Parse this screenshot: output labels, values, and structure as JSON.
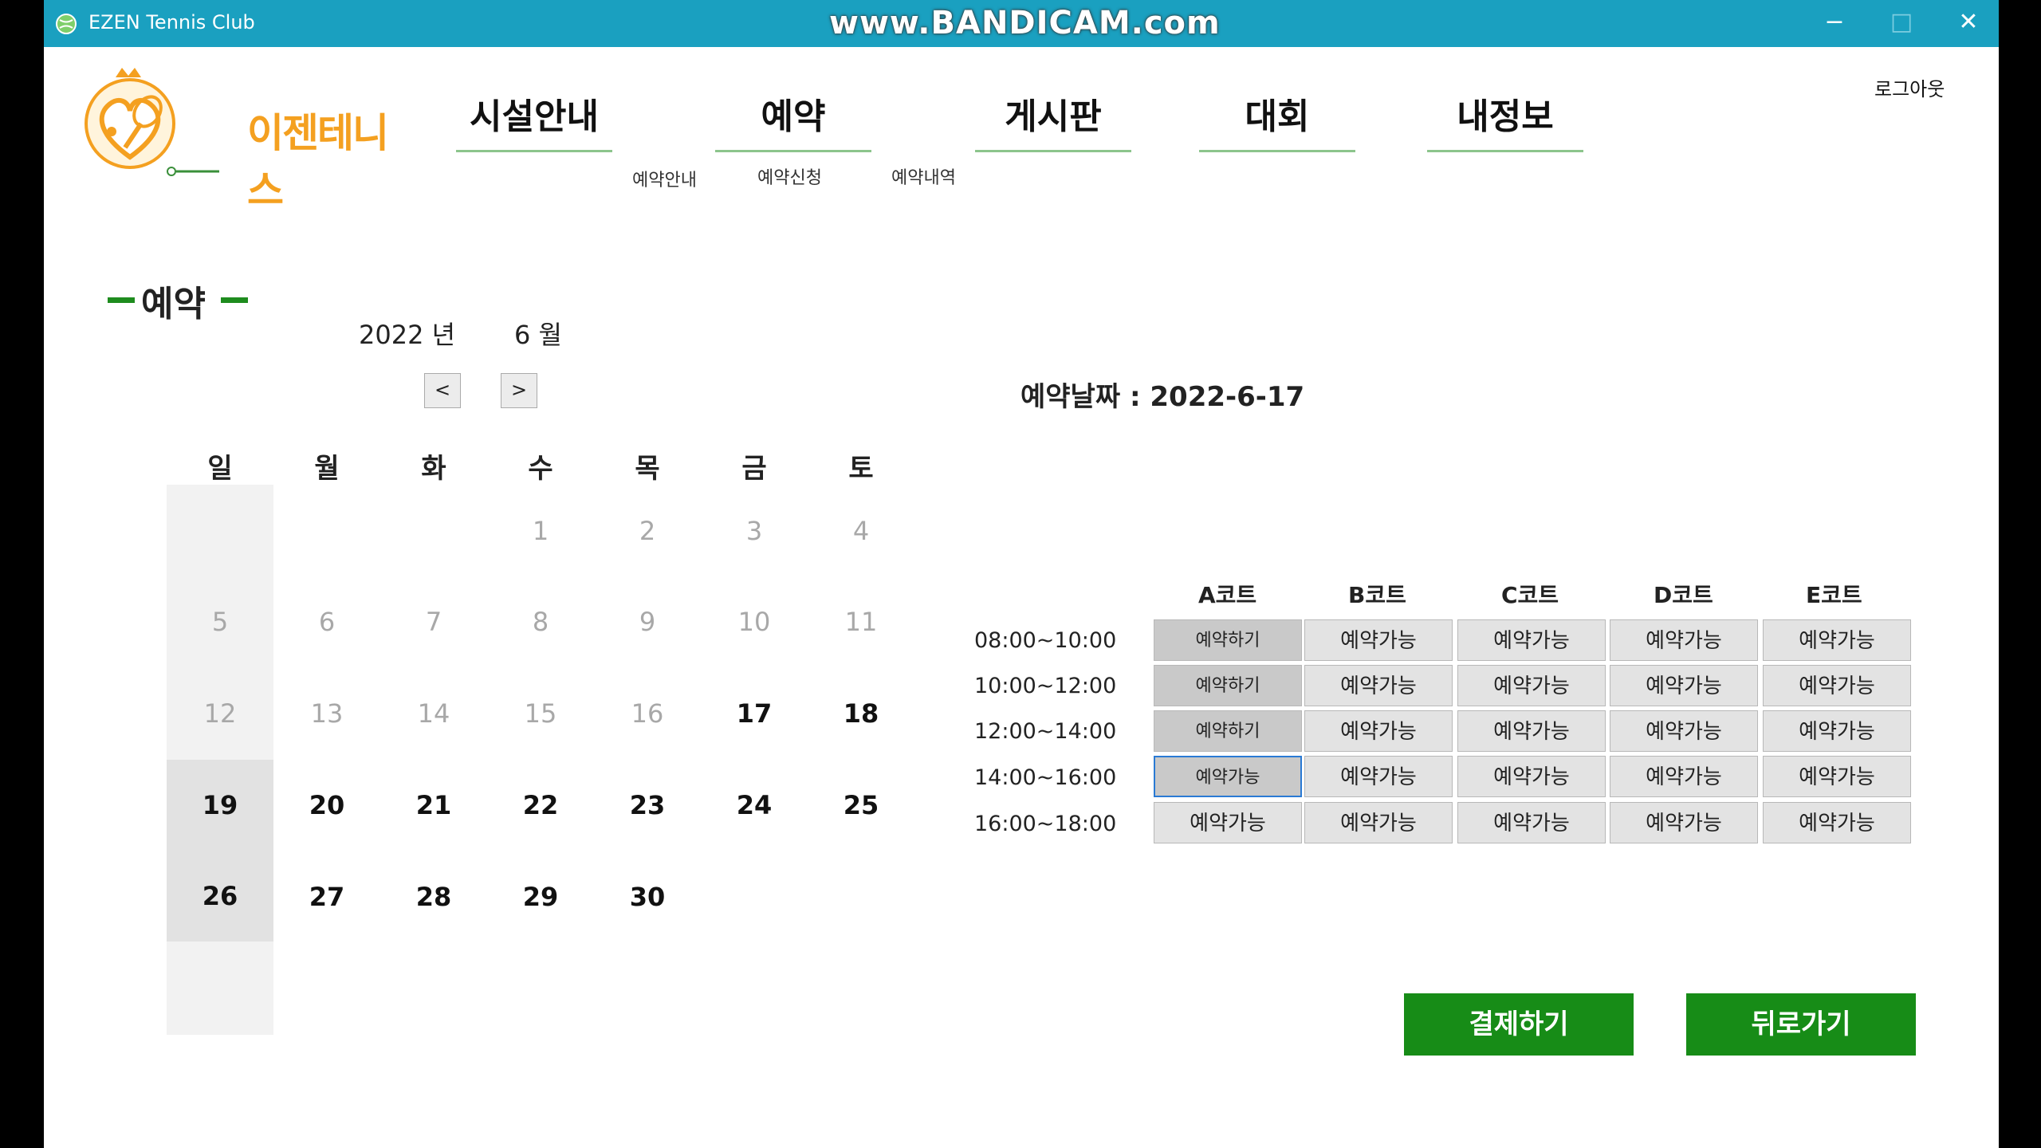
{
  "window": {
    "title": "EZEN Tennis Club",
    "watermark": "www.BANDICAM.com",
    "controls": {
      "minimize": "−",
      "maximize": "□",
      "close": "✕"
    }
  },
  "logo": {
    "text": "이젠테니스"
  },
  "nav": {
    "items": [
      {
        "label": "시설안내"
      },
      {
        "label": "예약"
      },
      {
        "label": "게시판"
      },
      {
        "label": "대회"
      },
      {
        "label": "내정보"
      }
    ],
    "sub_items": [
      {
        "label": "예약안내"
      },
      {
        "label": "예약신청"
      },
      {
        "label": "예약내역"
      }
    ],
    "logout": "로그아웃"
  },
  "section_title": "예약",
  "calendar": {
    "year_label": "2022 년",
    "month_label": "6 월",
    "prev_label": "<",
    "next_label": ">",
    "weekdays": [
      "일",
      "월",
      "화",
      "수",
      "목",
      "금",
      "토"
    ],
    "days": [
      "1",
      "2",
      "3",
      "4",
      "5",
      "6",
      "7",
      "8",
      "9",
      "10",
      "11",
      "12",
      "13",
      "14",
      "15",
      "16",
      "17",
      "18",
      "19",
      "20",
      "21",
      "22",
      "23",
      "24",
      "25",
      "26",
      "27",
      "28",
      "29",
      "30"
    ]
  },
  "reservation": {
    "date_label": "예약날짜 : 2022-6-17",
    "courts": [
      "A코트",
      "B코트",
      "C코트",
      "D코트",
      "E코트"
    ],
    "time_slots": [
      "08:00~10:00",
      "10:00~12:00",
      "12:00~14:00",
      "14:00~16:00",
      "16:00~18:00"
    ],
    "grid": [
      [
        "예약하기",
        "예약가능",
        "예약가능",
        "예약가능",
        "예약가능"
      ],
      [
        "예약하기",
        "예약가능",
        "예약가능",
        "예약가능",
        "예약가능"
      ],
      [
        "예약하기",
        "예약가능",
        "예약가능",
        "예약가능",
        "예약가능"
      ],
      [
        "예약가능",
        "예약가능",
        "예약가능",
        "예약가능",
        "예약가능"
      ],
      [
        "예약가능",
        "예약가능",
        "예약가능",
        "예약가능",
        "예약가능"
      ]
    ]
  },
  "actions": {
    "pay": "결제하기",
    "back": "뒤로가기"
  },
  "colors": {
    "titlebar": "#1aa0c0",
    "primary_green": "#178c17",
    "nav_underline": "#8cc58c",
    "logo_orange": "#f4a020"
  }
}
